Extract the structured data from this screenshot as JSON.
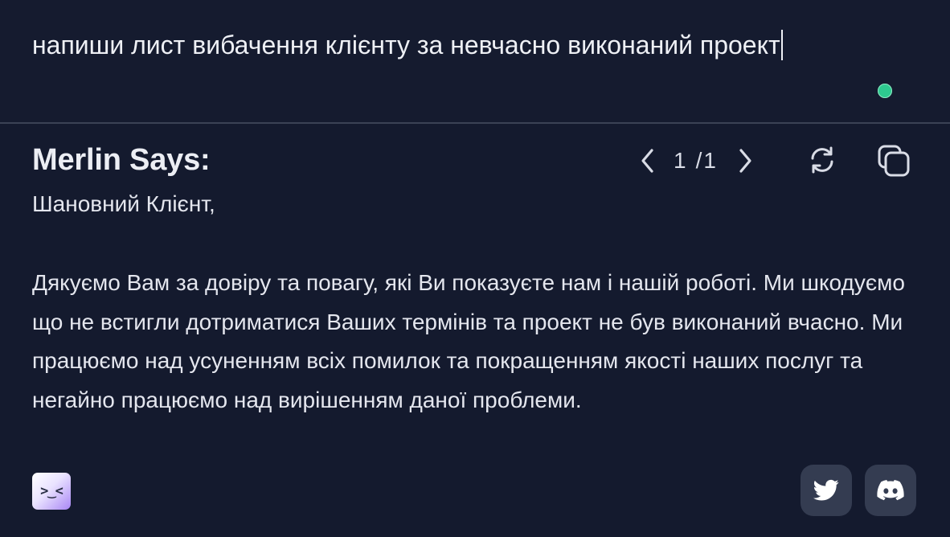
{
  "prompt": {
    "text": "напиши лист вибачення клієнту за невчасно виконаний проект"
  },
  "response": {
    "title": "Merlin Says:",
    "pager": {
      "current": "1",
      "total": "/1"
    },
    "greeting": "Шановний Клієнт,",
    "body": "Дякуємо Вам за довіру та повагу, які Ви показуєте нам і нашій роботі. Ми шкодуємо що не встигли дотриматися Ваших термінів та проект не був виконаний вчасно. Ми працюємо над усуненням всіх помилок та покращенням якості наших послуг та негайно працюємо над вирішенням даної проблеми."
  },
  "icons": {
    "prev": "chevron-left-icon",
    "next": "chevron-right-icon",
    "regenerate": "refresh-icon",
    "copy": "copy-icon",
    "twitter": "twitter-icon",
    "discord": "discord-icon",
    "logo": "merlin-logo"
  },
  "colors": {
    "background": "#141a2e",
    "status_dot": "#2ec98f",
    "social_button": "#343c51",
    "logo_accent": "#a987f5"
  }
}
